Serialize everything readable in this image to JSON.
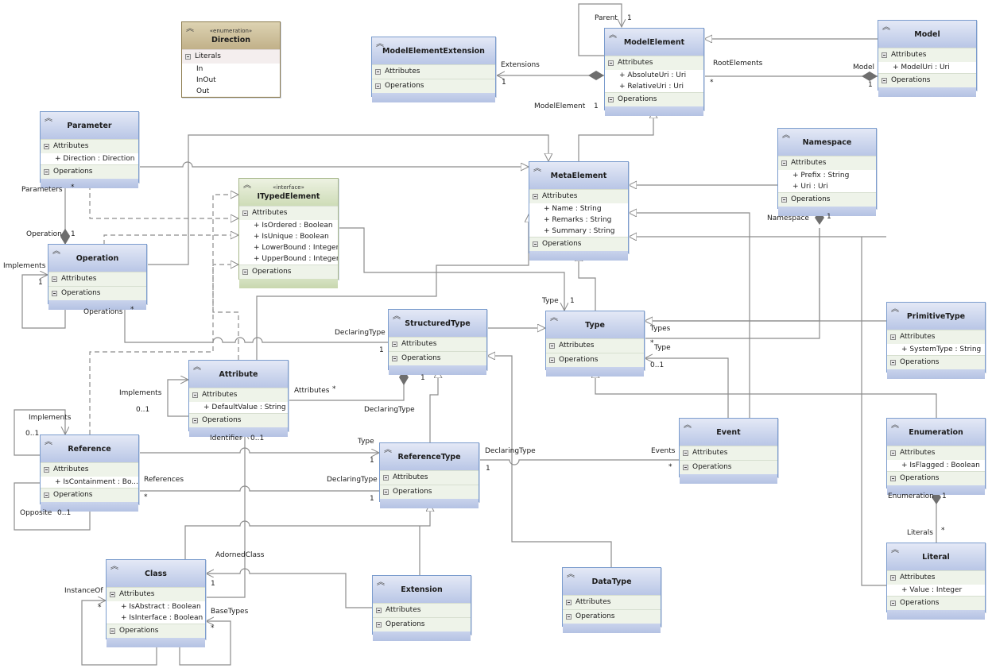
{
  "diagram": {
    "type": "UML class diagram",
    "section_labels": {
      "attributes": "Attributes",
      "operations": "Operations",
      "literals": "Literals"
    },
    "collapse_icon": "double-chevron-up-icon",
    "toggle_icon": "minus-box-icon"
  },
  "classes": {
    "direction": {
      "name": "Direction",
      "stereotype": "«enumeration»",
      "literals": [
        "In",
        "InOut",
        "Out"
      ]
    },
    "model_element_extension": {
      "name": "ModelElementExtension",
      "attributes": []
    },
    "model_element": {
      "name": "ModelElement",
      "attributes": [
        "+ AbsoluteUri : Uri",
        "+ RelativeUri : Uri"
      ]
    },
    "model": {
      "name": "Model",
      "attributes": [
        "+ ModelUri : Uri"
      ]
    },
    "parameter": {
      "name": "Parameter",
      "attributes": [
        "+ Direction : Direction"
      ]
    },
    "ityped_element": {
      "name": "ITypedElement",
      "stereotype": "«interface»",
      "attributes": [
        "+ IsOrdered : Boolean",
        "+ IsUnique : Boolean",
        "+ LowerBound : Integer",
        "+ UpperBound : Integer"
      ]
    },
    "meta_element": {
      "name": "MetaElement",
      "attributes": [
        "+ Name : String",
        "+ Remarks : String",
        "+ Summary : String"
      ]
    },
    "namespace": {
      "name": "Namespace",
      "attributes": [
        "+ Prefix : String",
        "+ Uri : Uri"
      ]
    },
    "operation": {
      "name": "Operation",
      "attributes": []
    },
    "structured_type": {
      "name": "StructuredType",
      "attributes": []
    },
    "type": {
      "name": "Type",
      "attributes": []
    },
    "primitive_type": {
      "name": "PrimitiveType",
      "attributes": [
        "+ SystemType : String"
      ]
    },
    "attribute": {
      "name": "Attribute",
      "attributes": [
        "+ DefaultValue : String"
      ]
    },
    "reference": {
      "name": "Reference",
      "attributes": [
        "+ IsContainment : Bo..."
      ]
    },
    "reference_type": {
      "name": "ReferenceType",
      "attributes": []
    },
    "event": {
      "name": "Event",
      "attributes": []
    },
    "enumeration": {
      "name": "Enumeration",
      "attributes": [
        "+ IsFlagged : Boolean"
      ]
    },
    "literal": {
      "name": "Literal",
      "attributes": [
        "+ Value : Integer"
      ]
    },
    "class": {
      "name": "Class",
      "attributes": [
        "+ IsAbstract : Boolean",
        "+ IsInterface : Boolean"
      ]
    },
    "extension": {
      "name": "Extension",
      "attributes": []
    },
    "data_type": {
      "name": "DataType",
      "attributes": []
    }
  },
  "labels": {
    "parent": "Parent",
    "parent_mult": "1",
    "extensions": "Extensions",
    "extensions_mult": "1",
    "model_element_role": "ModelElement",
    "model_element_mult": "1",
    "root_elements": "RootElements",
    "root_elements_mult": "*",
    "model_role": "Model",
    "model_mult": "1",
    "parameters": "Parameters",
    "parameters_mult": "*",
    "operation_role": "Operation",
    "operation_mult": "1",
    "op_implements": "Implements",
    "op_implements_mult": "1",
    "operations": "Operations",
    "operations_mult": "*",
    "namespace_role": "Namespace",
    "namespace_mult": "1",
    "type_role": "Type",
    "type_mult": "1",
    "types": "Types",
    "types_mult": "*",
    "event_type": "Type",
    "event_type_mult": "0..1",
    "declaring_type_1": "DeclaringType",
    "declaring_type_1_mult": "1",
    "attributes_role": "Attributes",
    "attributes_mult": "*",
    "declaring_type_2": "DeclaringType",
    "st_mult": "1",
    "attr_implements": "Implements",
    "attr_implements_mult": "0..1",
    "ref_implements": "Implements",
    "ref_implements_mult": "0..1",
    "identifier": "Identifier",
    "identifier_mult": "0..1",
    "ref_type": "Type",
    "ref_type_mult": "1",
    "references": "References",
    "references_mult": "*",
    "declaring_type_3": "DeclaringType",
    "declaring_type_3_mult": "1",
    "declaring_type_4": "DeclaringType",
    "declaring_type_4_mult": "1",
    "events": "Events",
    "events_mult": "*",
    "opposite": "Opposite",
    "opposite_mult": "0..1",
    "enumeration_role": "Enumeration",
    "enumeration_mult": "1",
    "literals_role": "Literals",
    "literals_mult": "*",
    "adorned_class": "AdornedClass",
    "adorned_class_mult": "1",
    "instance_of": "InstanceOf",
    "instance_of_mult": "*",
    "base_types": "BaseTypes",
    "base_types_mult": "*"
  }
}
